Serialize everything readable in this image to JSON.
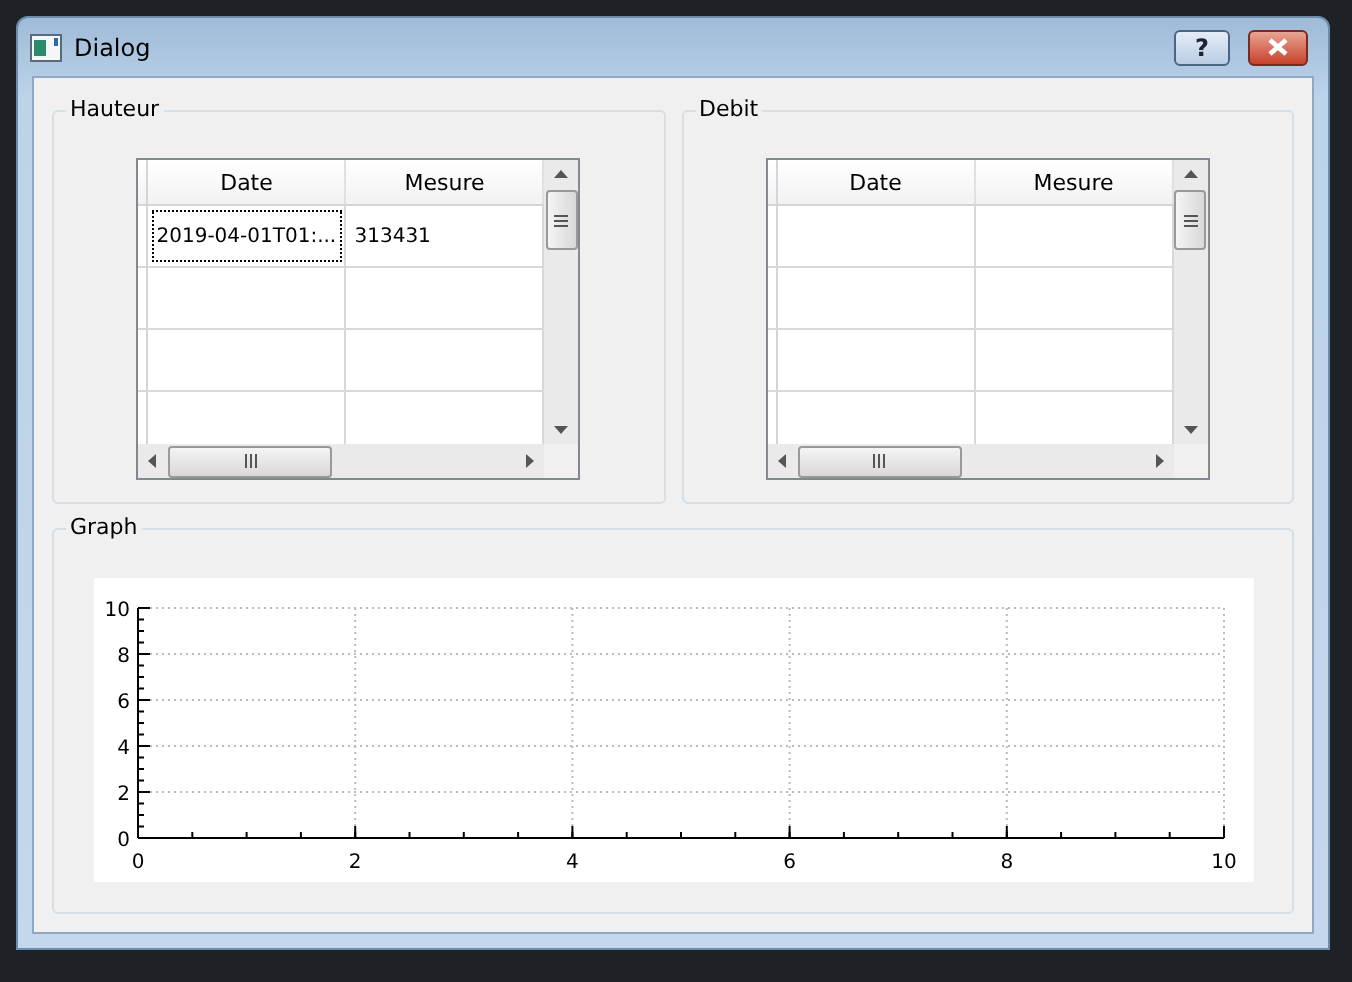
{
  "window": {
    "title": "Dialog",
    "help_button": "?"
  },
  "tables": [
    {
      "title": "Hauteur",
      "columns": [
        "Date",
        "Mesure"
      ],
      "rows": [
        {
          "cells": [
            "2019-04-01T01:...",
            "313431"
          ],
          "focused": true
        }
      ]
    },
    {
      "title": "Debit",
      "columns": [
        "Date",
        "Mesure"
      ]
    }
  ],
  "graph": {
    "title": "Graph",
    "chart_data": {
      "type": "line",
      "grid": true,
      "xlim": [
        0,
        10
      ],
      "ylim": [
        0,
        10
      ],
      "xticks": [
        0,
        2,
        4,
        6,
        8,
        10
      ],
      "yticks": [
        0,
        2,
        4,
        6,
        8,
        10
      ]
    }
  }
}
